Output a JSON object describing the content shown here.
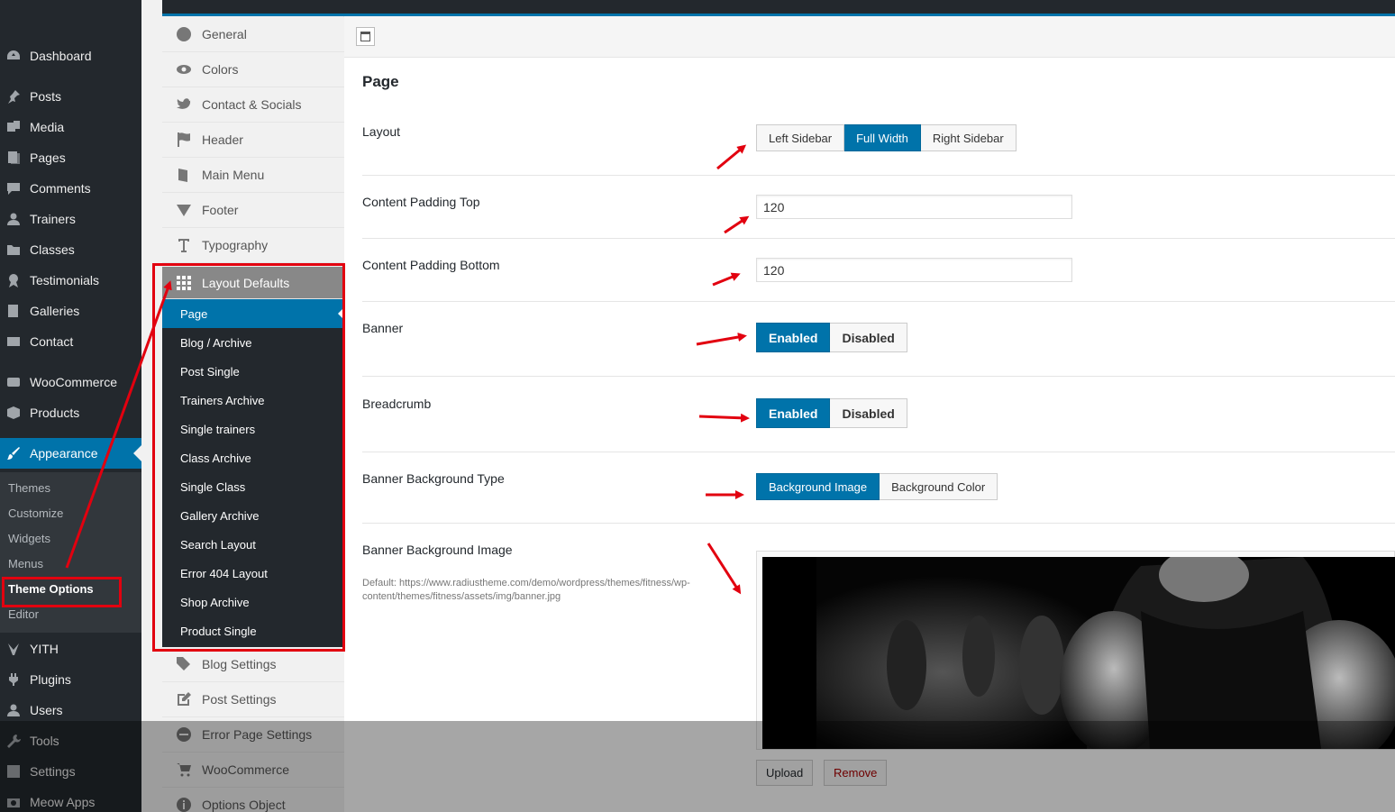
{
  "wp_menu": {
    "items": [
      {
        "label": "Dashboard",
        "icon": "dashboard-icon"
      },
      {
        "label": "Posts",
        "icon": "pin-icon"
      },
      {
        "label": "Media",
        "icon": "media-icon"
      },
      {
        "label": "Pages",
        "icon": "page-icon"
      },
      {
        "label": "Comments",
        "icon": "comment-icon"
      },
      {
        "label": "Trainers",
        "icon": "user-icon"
      },
      {
        "label": "Classes",
        "icon": "folder-icon"
      },
      {
        "label": "Testimonials",
        "icon": "award-icon"
      },
      {
        "label": "Galleries",
        "icon": "gallery-icon"
      },
      {
        "label": "Contact",
        "icon": "mail-icon"
      },
      {
        "label": "WooCommerce",
        "icon": "woo-icon"
      },
      {
        "label": "Products",
        "icon": "box-icon"
      },
      {
        "label": "Appearance",
        "icon": "brush-icon"
      },
      {
        "label": "YITH",
        "icon": "yith-icon"
      },
      {
        "label": "Plugins",
        "icon": "plug-icon"
      },
      {
        "label": "Users",
        "icon": "user-icon"
      },
      {
        "label": "Tools",
        "icon": "wrench-icon"
      },
      {
        "label": "Settings",
        "icon": "settings-icon"
      },
      {
        "label": "Meow Apps",
        "icon": "camera-icon"
      }
    ],
    "submenu": [
      "Themes",
      "Customize",
      "Widgets",
      "Menus",
      "Theme Options",
      "Editor"
    ]
  },
  "options_nav": {
    "items": [
      {
        "label": "General",
        "icon": "globe-icon"
      },
      {
        "label": "Colors",
        "icon": "eye-icon"
      },
      {
        "label": "Contact & Socials",
        "icon": "twitter-icon"
      },
      {
        "label": "Header",
        "icon": "flag-icon"
      },
      {
        "label": "Main Menu",
        "icon": "book-icon"
      },
      {
        "label": "Footer",
        "icon": "triangle-down-icon"
      },
      {
        "label": "Typography",
        "icon": "text-icon"
      },
      {
        "label": "Layout Defaults",
        "icon": "grid-icon"
      },
      {
        "label": "Blog Settings",
        "icon": "tags-icon"
      },
      {
        "label": "Post Settings",
        "icon": "edit-icon"
      },
      {
        "label": "Error Page Settings",
        "icon": "minus-circle-icon"
      },
      {
        "label": "WooCommerce",
        "icon": "cart-icon"
      },
      {
        "label": "Options Object",
        "icon": "info-icon"
      }
    ],
    "layout_sub": [
      "Page",
      "Blog / Archive",
      "Post Single",
      "Trainers Archive",
      "Single trainers",
      "Class Archive",
      "Single Class",
      "Gallery Archive",
      "Search Layout",
      "Error 404 Layout",
      "Shop Archive",
      "Product Single"
    ]
  },
  "page": {
    "title": "Page",
    "layout": {
      "label": "Layout",
      "options": [
        "Left Sidebar",
        "Full Width",
        "Right Sidebar"
      ],
      "selected": "Full Width"
    },
    "padding_top": {
      "label": "Content Padding Top",
      "value": "120"
    },
    "padding_bottom": {
      "label": "Content Padding Bottom",
      "value": "120"
    },
    "banner": {
      "label": "Banner",
      "options": [
        "Enabled",
        "Disabled"
      ],
      "selected": "Enabled"
    },
    "breadcrumb": {
      "label": "Breadcrumb",
      "options": [
        "Enabled",
        "Disabled"
      ],
      "selected": "Enabled"
    },
    "banner_bg_type": {
      "label": "Banner Background Type",
      "options": [
        "Background Image",
        "Background Color"
      ],
      "selected": "Background Image"
    },
    "banner_bg_image": {
      "label": "Banner Background Image",
      "default_note": "Default: https://www.radiustheme.com/demo/wordpress/themes/fitness/wp-content/themes/fitness/assets/img/banner.jpg",
      "upload": "Upload",
      "remove": "Remove"
    }
  },
  "colors": {
    "accent": "#0073aa",
    "admin_dark": "#23282d",
    "annotation": "#e2000f"
  }
}
